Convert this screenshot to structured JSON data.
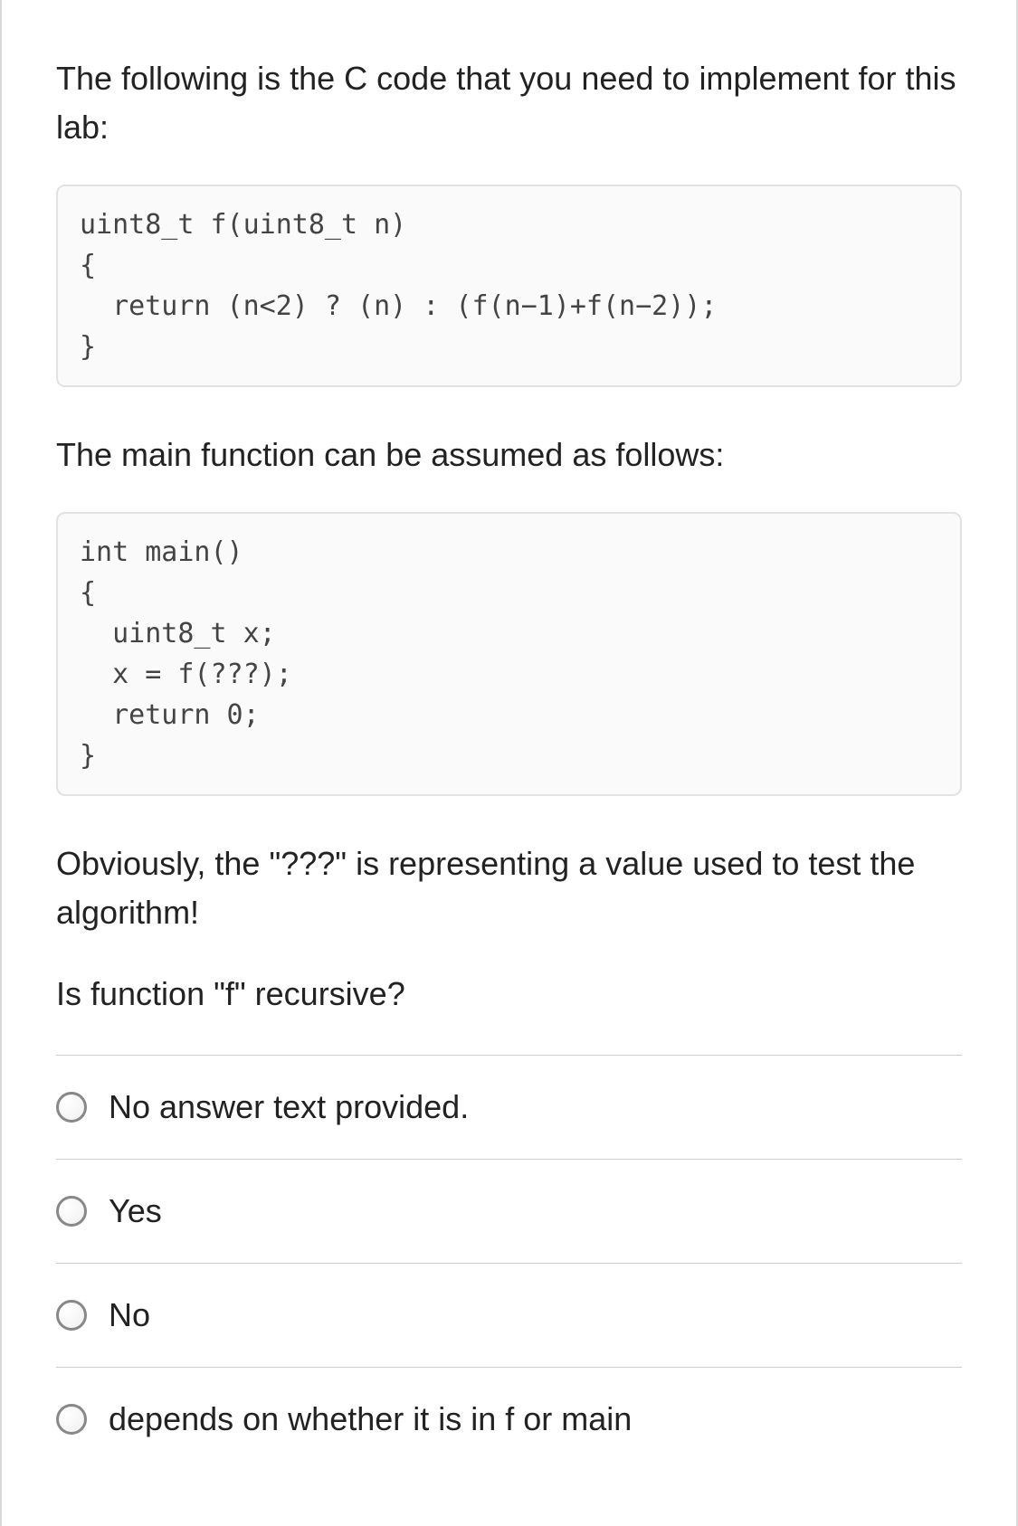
{
  "paragraphs": {
    "intro": "The following is the C code that you need to implement for this lab:",
    "main_note": "The main function can be assumed as follows:",
    "obviously": "Obviously, the \"???\" is representing a value used to test the algorithm!",
    "question": "Is function \"f\" recursive?"
  },
  "code": {
    "f": "uint8_t f(uint8_t n)\n{\n  return (n<2) ? (n) : (f(n−1)+f(n−2));\n}",
    "main": "int main()\n{\n  uint8_t x;\n  x = f(???);\n  return 0;\n}"
  },
  "answers": [
    {
      "label": "No answer text provided."
    },
    {
      "label": "Yes"
    },
    {
      "label": "No"
    },
    {
      "label": "depends on whether it is in f or main"
    }
  ]
}
